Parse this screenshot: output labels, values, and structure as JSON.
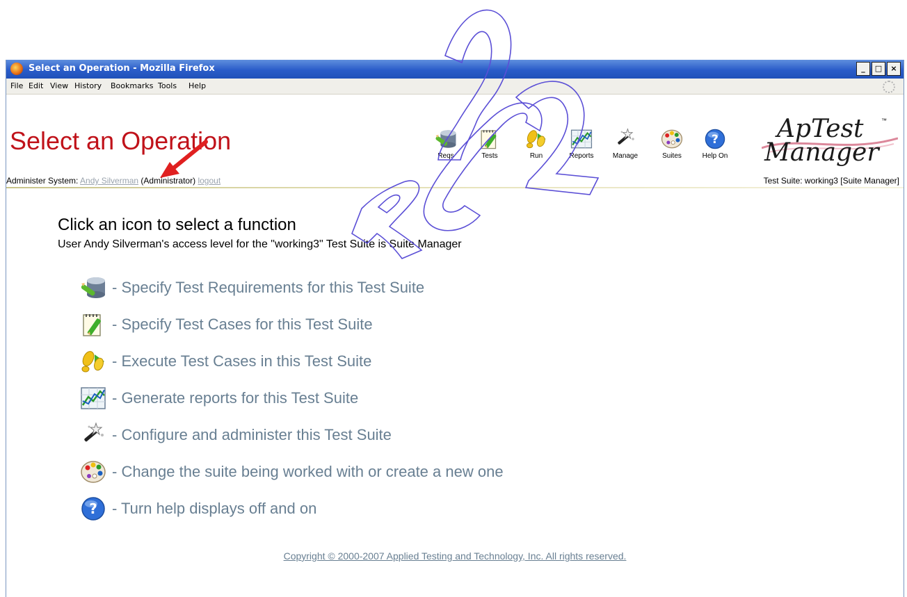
{
  "window": {
    "title": "Select an Operation - Mozilla Firefox",
    "controls": [
      "_",
      "□",
      "×"
    ]
  },
  "menubar": {
    "items": [
      "File",
      "Edit",
      "View",
      "History",
      "Bookmarks",
      "Tools",
      "Help"
    ]
  },
  "page": {
    "title": "Select an Operation"
  },
  "toolbar": {
    "items": [
      {
        "label": "Reqs",
        "icon": "database-pencil-icon"
      },
      {
        "label": "Tests",
        "icon": "notepad-pencil-icon"
      },
      {
        "label": "Run",
        "icon": "footprints-icon"
      },
      {
        "label": "Reports",
        "icon": "chart-icon"
      },
      {
        "label": "Manage",
        "icon": "magic-wand-icon"
      },
      {
        "label": "Suites",
        "icon": "palette-icon"
      },
      {
        "label": "Help On",
        "icon": "help-icon"
      }
    ]
  },
  "logo": {
    "line1": "ApTest",
    "line2": "Manager",
    "tm": "™"
  },
  "infobar": {
    "prefix": "Administer System:",
    "user": "Andy Silverman",
    "role": "(Administrator)",
    "logout": "logout",
    "suite": "Test Suite: working3 [Suite Manager]"
  },
  "main": {
    "heading": "Click an icon to select a function",
    "subheading": "User Andy Silverman's access level for the \"working3\" Test Suite is Suite Manager",
    "functions": [
      {
        "text": "- Specify Test Requirements for this Test Suite",
        "icon": "database-pencil-icon"
      },
      {
        "text": "- Specify Test Cases for this Test Suite",
        "icon": "notepad-pencil-icon"
      },
      {
        "text": "- Execute Test Cases in this Test Suite",
        "icon": "footprints-icon"
      },
      {
        "text": "- Generate reports for this Test Suite",
        "icon": "chart-icon"
      },
      {
        "text": "- Configure and administer this Test Suite",
        "icon": "magic-wand-icon"
      },
      {
        "text": "- Change the suite being worked with or create a new one",
        "icon": "palette-icon"
      },
      {
        "text": "- Turn help displays off and on",
        "icon": "help-icon"
      }
    ]
  },
  "footer": {
    "copyright": "Copyright © 2000-2007 Applied Testing and Technology, Inc. All rights reserved."
  },
  "overlay": {
    "watermark": "RC2",
    "watermark_color": "#5b4fd6",
    "arrow_color": "#e02020"
  }
}
